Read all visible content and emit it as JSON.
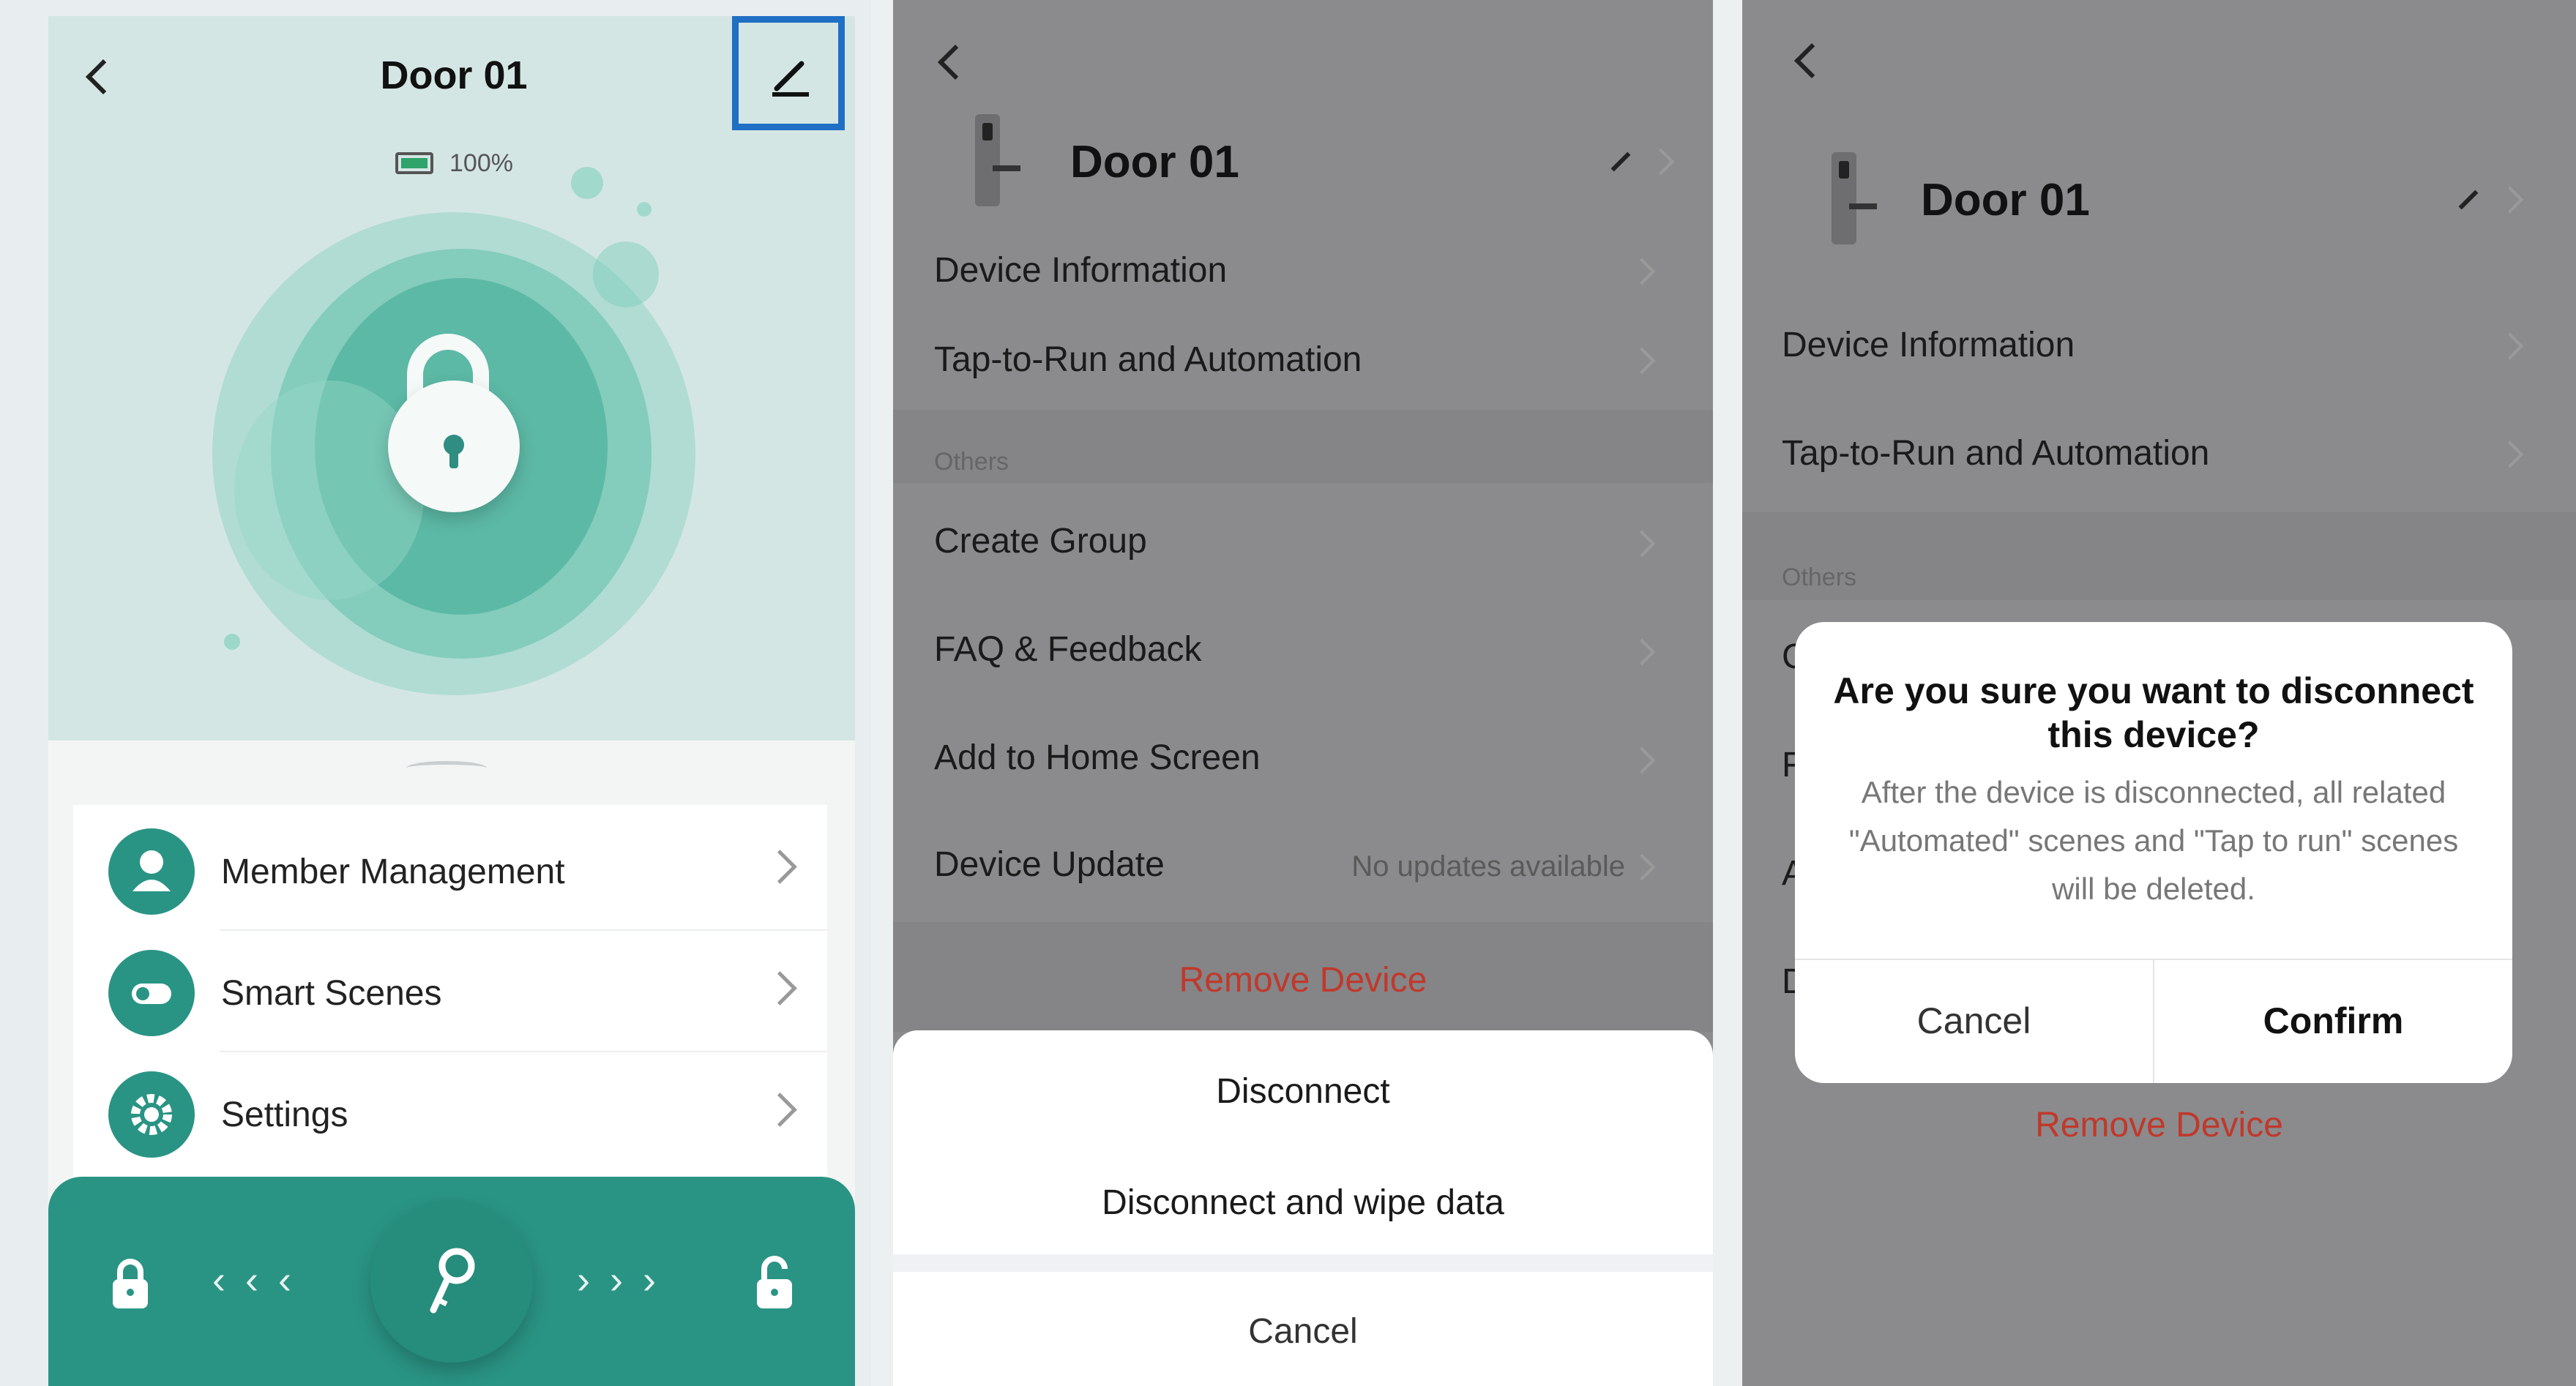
{
  "panel1": {
    "title": "Door 01",
    "battery_percent": "100%",
    "battery_level": 1.0,
    "menu": [
      {
        "label": "Member Management",
        "icon": "person-icon"
      },
      {
        "label": "Smart Scenes",
        "icon": "toggle-icon"
      },
      {
        "label": "Settings",
        "icon": "gear-icon"
      }
    ],
    "controls": {
      "lock_icon": "lock-icon",
      "unlock_icon": "unlock-icon",
      "key_icon": "key-icon",
      "left_arrows": "‹ ‹ ‹",
      "right_arrows": "› › ›"
    },
    "colors": {
      "accent": "#2a9484",
      "highlight_box": "#1f6fc4"
    }
  },
  "panel2": {
    "device_name": "Door 01",
    "items_top": [
      "Device Information",
      "Tap-to-Run and Automation"
    ],
    "section": "Others",
    "items_others": [
      "Create Group",
      "FAQ & Feedback",
      "Add to Home Screen"
    ],
    "device_update": {
      "label": "Device Update",
      "status": "No updates available"
    },
    "remove_device": "Remove Device",
    "action_sheet": {
      "options": [
        "Disconnect",
        "Disconnect and wipe data"
      ],
      "cancel": "Cancel"
    }
  },
  "panel3": {
    "device_name": "Door 01",
    "items_top": [
      "Device Information",
      "Tap-to-Run and Automation"
    ],
    "section": "Others",
    "hidden_initials": [
      "C",
      "F",
      "A",
      "D"
    ],
    "remove_device": "Remove Device",
    "dialog": {
      "title": "Are you sure you want to disconnect this device?",
      "message": "After the device is disconnected, all related \"Automated\" scenes and \"Tap to run\" scenes will be deleted.",
      "cancel": "Cancel",
      "confirm": "Confirm"
    }
  }
}
